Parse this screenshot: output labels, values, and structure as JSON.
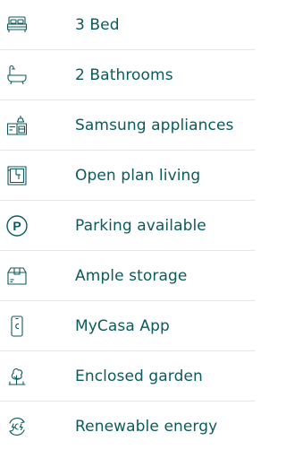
{
  "features": [
    {
      "label": "3 Bed",
      "icon": "bed-icon"
    },
    {
      "label": "2 Bathrooms",
      "icon": "bathtub-icon"
    },
    {
      "label": "Samsung appliances",
      "icon": "kitchen-appliances-icon"
    },
    {
      "label": "Open plan living",
      "icon": "floor-plan-icon"
    },
    {
      "label": "Parking available",
      "icon": "parking-icon"
    },
    {
      "label": "Ample storage",
      "icon": "storage-box-icon"
    },
    {
      "label": "MyCasa App",
      "icon": "mobile-app-icon"
    },
    {
      "label": "Enclosed garden",
      "icon": "garden-tree-icon"
    },
    {
      "label": "Renewable energy",
      "icon": "renewable-energy-icon"
    }
  ],
  "colors": {
    "accent": "#0c5a5e",
    "divider": "#e6e8e8",
    "background": "#ffffff"
  }
}
